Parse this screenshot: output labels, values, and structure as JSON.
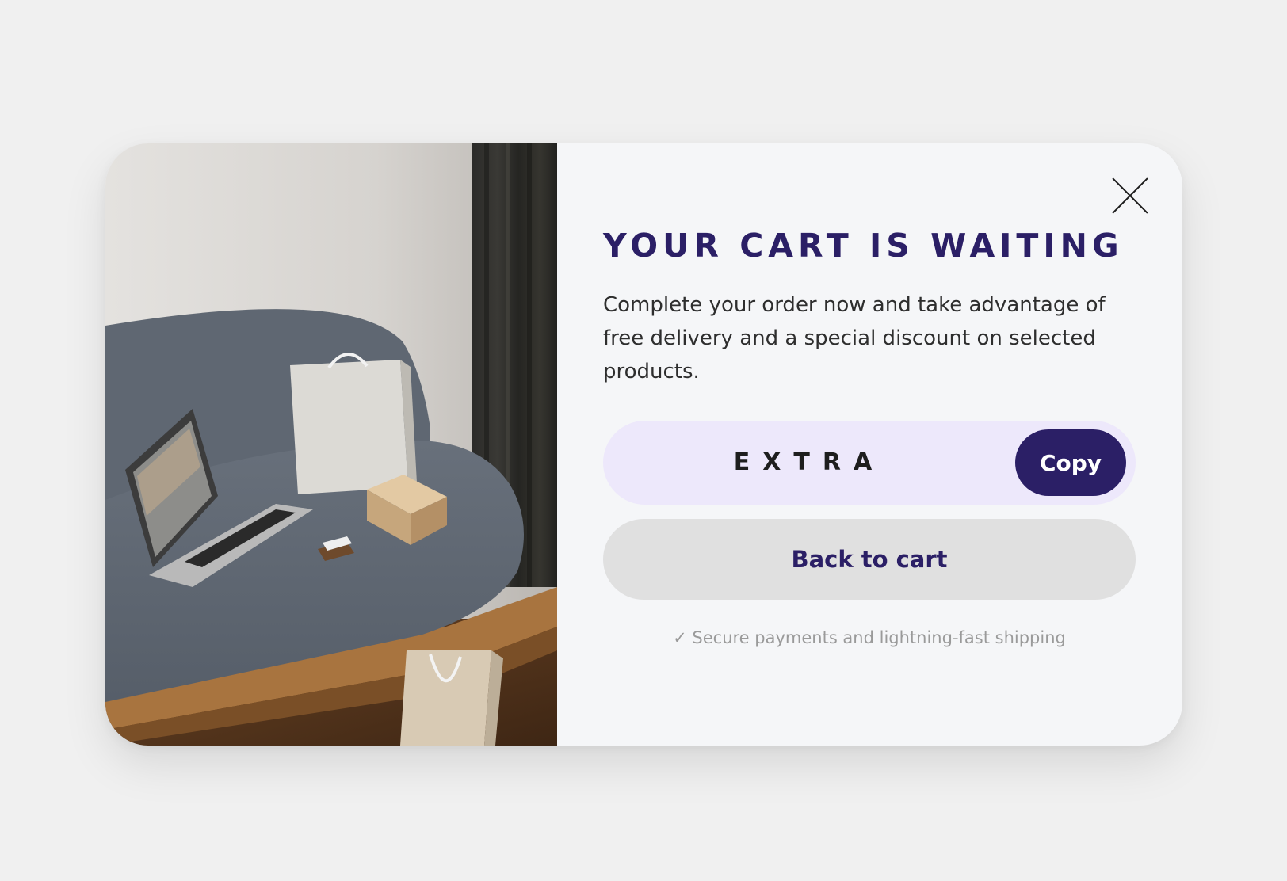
{
  "popup": {
    "title": "YOUR CART IS WAITING",
    "description": "Complete your order now and take advantage of free delivery and a special discount on selected products.",
    "discount_code": "EXTRA",
    "copy_label": "Copy",
    "back_label": "Back to cart",
    "secure_text": "✓ Secure payments and lightning-fast shipping",
    "close_icon": "close-icon"
  },
  "colors": {
    "page_background": "#f0f0f0",
    "modal_background": "#f5f6f8",
    "brand_primary": "#2b1f66",
    "code_box_background": "#ede8fb",
    "secondary_button_background": "#e0e0e0",
    "muted_text": "#9a9a9a"
  }
}
